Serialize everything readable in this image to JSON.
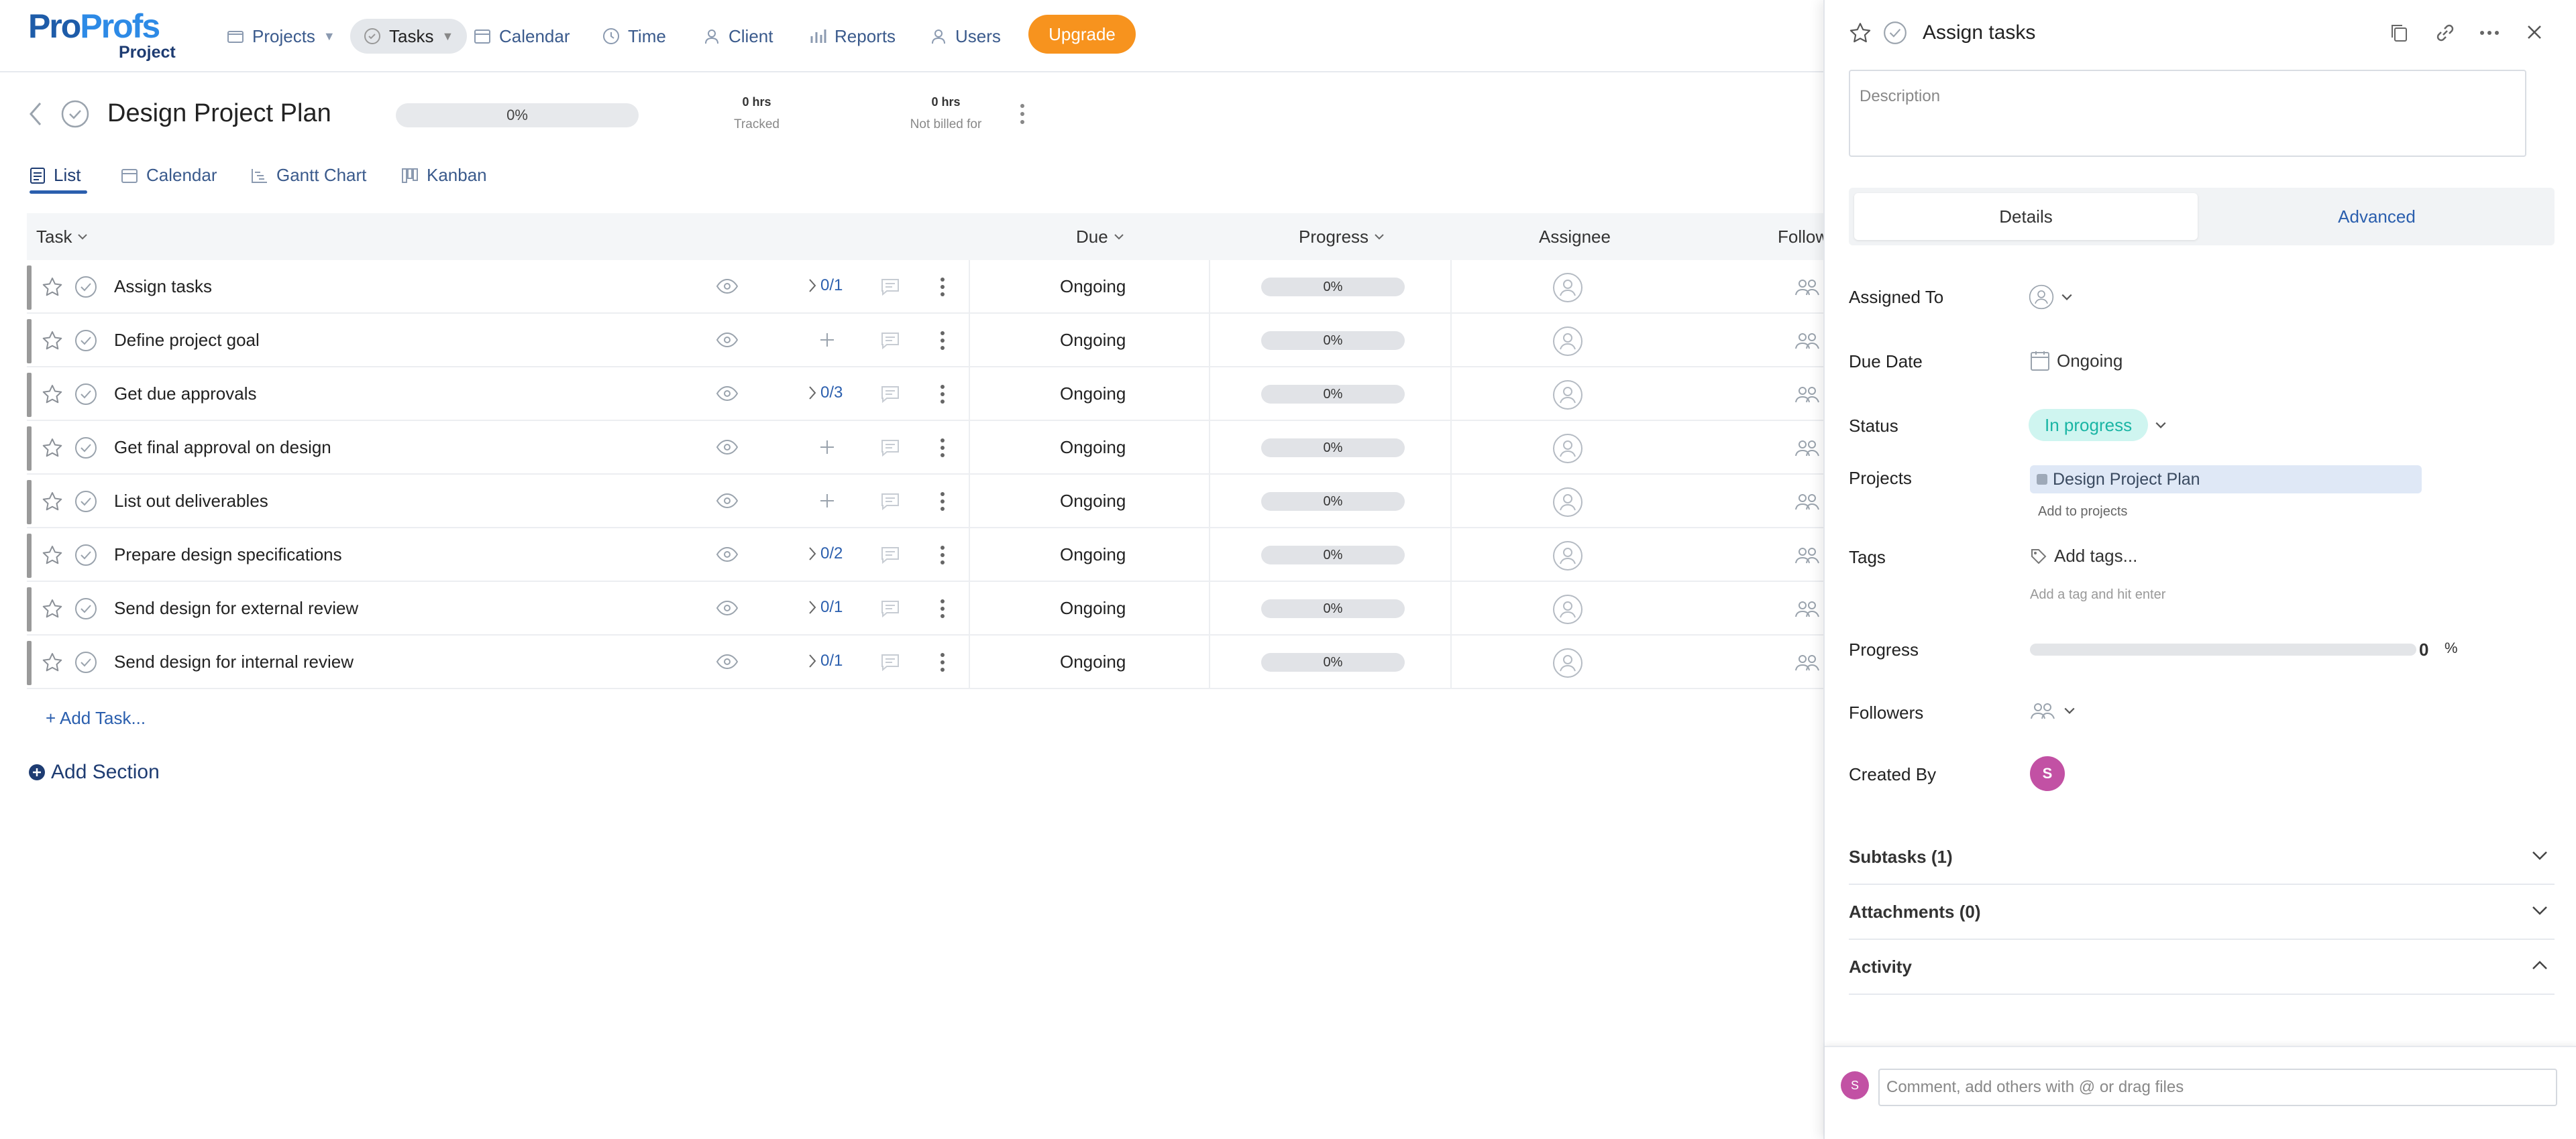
{
  "brand": {
    "logo_pro": "Pro",
    "logo_profs": "Profs",
    "logo_sub": "Project"
  },
  "nav": {
    "projects": "Projects",
    "tasks": "Tasks",
    "calendar": "Calendar",
    "time": "Time",
    "client": "Client",
    "reports": "Reports",
    "users": "Users",
    "upgrade": "Upgrade"
  },
  "project": {
    "title": "Design Project Plan",
    "progress_label": "0%",
    "tracked_value": "0 hrs",
    "tracked_label": "Tracked",
    "notbilled_value": "0 hrs",
    "notbilled_label": "Not billed for"
  },
  "view_tabs": {
    "list": "List",
    "calendar": "Calendar",
    "gantt": "Gantt Chart",
    "kanban": "Kanban"
  },
  "table": {
    "headers": {
      "task": "Task",
      "due": "Due",
      "progress": "Progress",
      "assignee": "Assignee",
      "followers": "Follow"
    },
    "rows": [
      {
        "name": "Assign tasks",
        "subtasks": "0/1",
        "due": "Ongoing",
        "progress": "0%"
      },
      {
        "name": "Define project goal",
        "subtasks": "",
        "due": "Ongoing",
        "progress": "0%"
      },
      {
        "name": "Get due approvals",
        "subtasks": "0/3",
        "due": "Ongoing",
        "progress": "0%"
      },
      {
        "name": "Get final approval on design",
        "subtasks": "",
        "due": "Ongoing",
        "progress": "0%"
      },
      {
        "name": "List out deliverables",
        "subtasks": "",
        "due": "Ongoing",
        "progress": "0%"
      },
      {
        "name": "Prepare design specifications",
        "subtasks": "0/2",
        "due": "Ongoing",
        "progress": "0%"
      },
      {
        "name": "Send design for external review",
        "subtasks": "0/1",
        "due": "Ongoing",
        "progress": "0%"
      },
      {
        "name": "Send design for internal review",
        "subtasks": "0/1",
        "due": "Ongoing",
        "progress": "0%"
      }
    ],
    "add_task": "+ Add Task...",
    "add_section": "Add Section"
  },
  "panel": {
    "title": "Assign tasks",
    "description_placeholder": "Description",
    "tabs": {
      "details": "Details",
      "advanced": "Advanced"
    },
    "labels": {
      "assigned_to": "Assigned To",
      "due_date": "Due Date",
      "status": "Status",
      "projects": "Projects",
      "tags": "Tags",
      "progress": "Progress",
      "followers": "Followers",
      "created_by": "Created By"
    },
    "due_date_value": "Ongoing",
    "status_value": "In progress",
    "project_chip": "Design Project Plan",
    "add_to_projects": "Add to projects",
    "add_tags": "Add tags...",
    "tag_hint": "Add a tag and hit enter",
    "progress_value": "0",
    "progress_unit": "%",
    "progress_fraction": 0,
    "creator_initial": "S",
    "sections": {
      "subtasks": "Subtasks (1)",
      "attachments": "Attachments (0)",
      "activity": "Activity"
    },
    "comment_avatar": "S",
    "comment_placeholder": "Comment, add others with @ or drag files"
  },
  "colors": {
    "accent": "#2b5fae",
    "upgrade": "#f7931e",
    "status_bg": "#cff5f0",
    "status_text": "#1ab5a4",
    "avatar": "#c251a4"
  }
}
